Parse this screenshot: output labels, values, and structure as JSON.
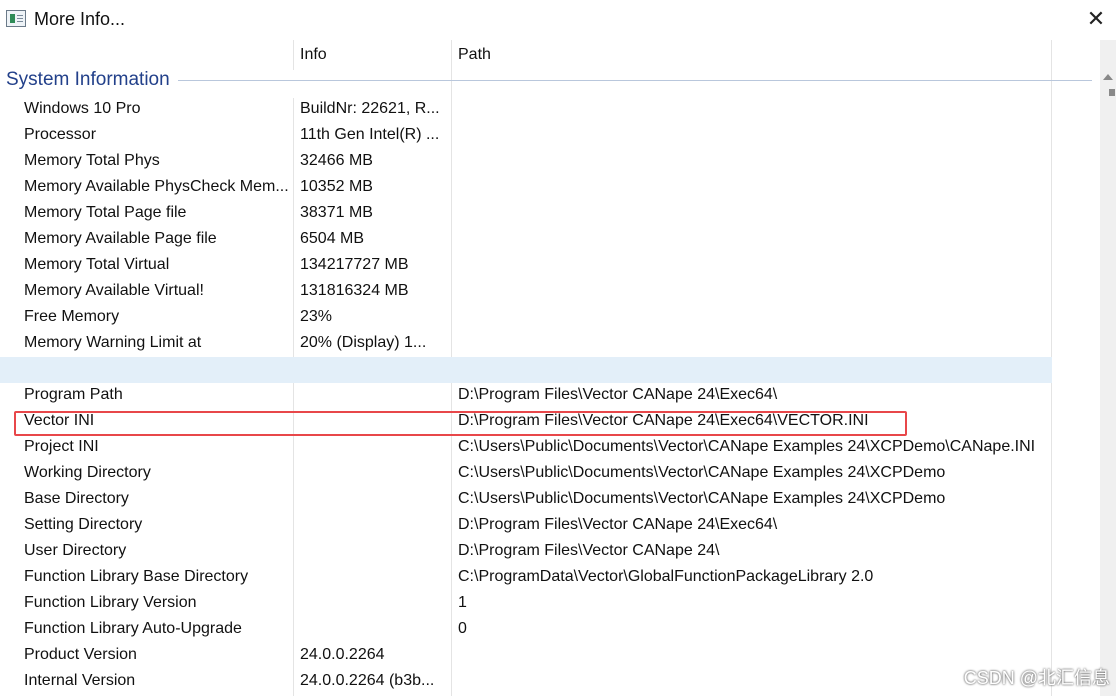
{
  "window": {
    "title": "More Info...",
    "close_symbol": "✕"
  },
  "columns": {
    "name": "",
    "info": "Info",
    "path": "Path"
  },
  "section": {
    "title": "System Information"
  },
  "system_rows": [
    {
      "name": "Windows 10 Pro",
      "info": "BuildNr: 22621, R...",
      "path": ""
    },
    {
      "name": "Processor",
      "info": "11th Gen Intel(R) ...",
      "path": ""
    },
    {
      "name": "Memory Total Phys",
      "info": "32466 MB",
      "path": ""
    },
    {
      "name": "Memory Available PhysCheck Mem...",
      "info": "10352 MB",
      "path": ""
    },
    {
      "name": "Memory Total Page file",
      "info": "38371 MB",
      "path": ""
    },
    {
      "name": "Memory Available Page file",
      "info": "6504 MB",
      "path": ""
    },
    {
      "name": "Memory Total Virtual",
      "info": "134217727 MB",
      "path": ""
    },
    {
      "name": "Memory Available Virtual!",
      "info": "131816324 MB",
      "path": ""
    },
    {
      "name": "Free Memory",
      "info": "23%",
      "path": ""
    },
    {
      "name": "Memory Warning Limit at",
      "info": "20% (Display)  1...",
      "path": ""
    }
  ],
  "path_rows": [
    {
      "name": "Program Path",
      "info": "",
      "path": "D:\\Program Files\\Vector CANape 24\\Exec64\\"
    },
    {
      "name": "Vector INI",
      "info": "",
      "path": "D:\\Program Files\\Vector CANape 24\\Exec64\\VECTOR.INI"
    },
    {
      "name": "Project INI",
      "info": "",
      "path": "C:\\Users\\Public\\Documents\\Vector\\CANape Examples 24\\XCPDemo\\CANape.INI"
    },
    {
      "name": "Working Directory",
      "info": "",
      "path": "C:\\Users\\Public\\Documents\\Vector\\CANape Examples 24\\XCPDemo"
    },
    {
      "name": "Base Directory",
      "info": "",
      "path": "C:\\Users\\Public\\Documents\\Vector\\CANape Examples 24\\XCPDemo"
    },
    {
      "name": "Setting Directory",
      "info": "",
      "path": "D:\\Program Files\\Vector CANape 24\\Exec64\\"
    },
    {
      "name": "User Directory",
      "info": "",
      "path": "D:\\Program Files\\Vector CANape 24\\"
    },
    {
      "name": "Function Library Base Directory",
      "info": "",
      "path": "C:\\ProgramData\\Vector\\GlobalFunctionPackageLibrary 2.0"
    },
    {
      "name": "Function Library Version",
      "info": "",
      "path": "1"
    },
    {
      "name": "Function Library Auto-Upgrade",
      "info": "",
      "path": "0"
    },
    {
      "name": "Product Version",
      "info": "24.0.0.2264",
      "path": ""
    },
    {
      "name": "Internal Version",
      "info": "24.0.0.2264 (b3b...",
      "path": ""
    }
  ],
  "watermark": "CSDN @北汇信息",
  "colors": {
    "section_title": "#22408a",
    "highlight_border": "#e8474a",
    "blank_row": "#e3eff9"
  },
  "icons": {
    "app": "app-window-icon",
    "close": "close-icon",
    "scroll_up": "scroll-up-arrow-icon"
  }
}
